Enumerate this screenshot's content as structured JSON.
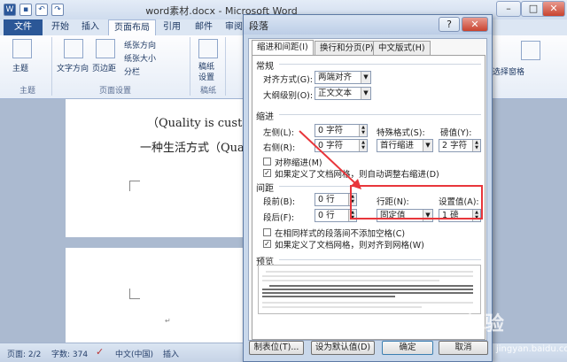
{
  "window": {
    "title": "word素材.docx - Microsoft Word",
    "min": "–",
    "max": "□",
    "close": "✕"
  },
  "ribbon": {
    "tabs": [
      "文件",
      "开始",
      "插入",
      "页面布局",
      "引用",
      "邮件",
      "审阅"
    ],
    "themes_label": "主题",
    "text_direction": "文字方向",
    "margins": "页边距",
    "orientation": "纸张方向",
    "size": "纸张大小",
    "columns": "分栏",
    "group_themes": "主题",
    "group_page_setup": "页面设置",
    "draft": "稿纸",
    "draft_setup": "设置",
    "group_draft": "稿纸",
    "select_pane": "选择窗格"
  },
  "document": {
    "line1": "（Quality is custome",
    "line2": "一种生活方式（Qua"
  },
  "status": {
    "page": "页面: 2/2",
    "words": "字数: 374",
    "language": "中文(中国)",
    "insert": "插入"
  },
  "dialog": {
    "title": "段落",
    "help": "?",
    "close": "✕",
    "tabs": [
      "缩进和间距(I)",
      "换行和分页(P)",
      "中文版式(H)"
    ],
    "general": {
      "heading": "常规",
      "alignment_label": "对齐方式(G):",
      "alignment_value": "两端对齐",
      "outline_label": "大纲级别(O):",
      "outline_value": "正文文本"
    },
    "indent": {
      "heading": "缩进",
      "left_label": "左侧(L):",
      "left_value": "0 字符",
      "right_label": "右侧(R):",
      "right_value": "0 字符",
      "special_label": "特殊格式(S):",
      "special_value": "首行缩进",
      "by_label": "磅值(Y):",
      "by_value": "2 字符",
      "mirror": "对称缩进(M)",
      "auto_adjust": "如果定义了文档网格，则自动调整右缩进(D)"
    },
    "spacing": {
      "heading": "间距",
      "before_label": "段前(B):",
      "before_value": "0 行",
      "after_label": "段后(F):",
      "after_value": "0 行",
      "line_label": "行距(N):",
      "line_value": "固定值",
      "at_label": "设置值(A):",
      "at_value": "1 磅",
      "no_space": "在相同样式的段落间不添加空格(C)",
      "snap_grid": "如果定义了文档网格，则对齐到网格(W)"
    },
    "preview": {
      "heading": "预览"
    },
    "buttons": {
      "tabs": "制表位(T)...",
      "default": "设为默认值(D)",
      "ok": "确定",
      "cancel": "取消"
    }
  },
  "watermark": {
    "text": "Bai 经验",
    "url": "jingyan.baidu.com"
  },
  "colors": {
    "accent": "#2b5797",
    "annotation": "#e8363b"
  }
}
